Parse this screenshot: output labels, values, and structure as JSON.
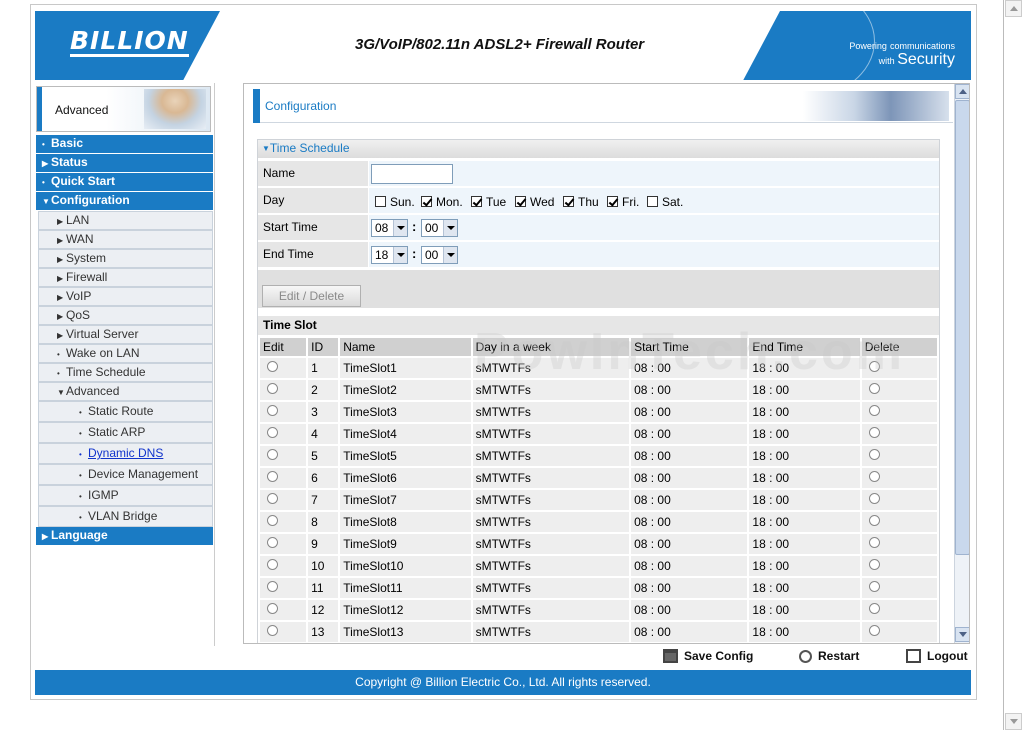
{
  "header": {
    "brand": "BILLION",
    "title": "3G/VoIP/802.11n ADSL2+ Firewall Router",
    "tagline_main": "Powering",
    "tagline_small": "communications",
    "tagline_with": "with",
    "tagline_security": "Security"
  },
  "sidebar": {
    "banner_label": "Advanced",
    "top_items": [
      "Basic",
      "Status",
      "Quick Start",
      "Configuration"
    ],
    "config_items": [
      "LAN",
      "WAN",
      "System",
      "Firewall",
      "VoIP",
      "QoS",
      "Virtual Server",
      "Wake on LAN",
      "Time Schedule",
      "Advanced"
    ],
    "advanced_items": [
      "Static Route",
      "Static ARP",
      "Dynamic DNS",
      "Device Management",
      "IGMP",
      "VLAN Bridge"
    ],
    "language": "Language"
  },
  "main": {
    "title": "Configuration",
    "section_title": "Time Schedule",
    "form": {
      "name_label": "Name",
      "name_value": "",
      "day_label": "Day",
      "days": [
        {
          "label": "Sun.",
          "checked": false
        },
        {
          "label": "Mon.",
          "checked": true
        },
        {
          "label": "Tue",
          "checked": true
        },
        {
          "label": "Wed",
          "checked": true
        },
        {
          "label": "Thu",
          "checked": true
        },
        {
          "label": "Fri.",
          "checked": true
        },
        {
          "label": "Sat.",
          "checked": false
        }
      ],
      "start_label": "Start Time",
      "start_hour": "08",
      "start_min": "00",
      "end_label": "End Time",
      "end_hour": "18",
      "end_min": "00",
      "colon": ":",
      "edit_delete_label": "Edit / Delete"
    },
    "timeslot": {
      "heading": "Time Slot",
      "columns": [
        "Edit",
        "ID",
        "Name",
        "Day in a week",
        "Start Time",
        "End Time",
        "Delete"
      ],
      "rows": [
        {
          "id": "1",
          "name": "TimeSlot1",
          "day": "sMTWTFs",
          "start": "08 : 00",
          "end": "18 : 00"
        },
        {
          "id": "2",
          "name": "TimeSlot2",
          "day": "sMTWTFs",
          "start": "08 : 00",
          "end": "18 : 00"
        },
        {
          "id": "3",
          "name": "TimeSlot3",
          "day": "sMTWTFs",
          "start": "08 : 00",
          "end": "18 : 00"
        },
        {
          "id": "4",
          "name": "TimeSlot4",
          "day": "sMTWTFs",
          "start": "08 : 00",
          "end": "18 : 00"
        },
        {
          "id": "5",
          "name": "TimeSlot5",
          "day": "sMTWTFs",
          "start": "08 : 00",
          "end": "18 : 00"
        },
        {
          "id": "6",
          "name": "TimeSlot6",
          "day": "sMTWTFs",
          "start": "08 : 00",
          "end": "18 : 00"
        },
        {
          "id": "7",
          "name": "TimeSlot7",
          "day": "sMTWTFs",
          "start": "08 : 00",
          "end": "18 : 00"
        },
        {
          "id": "8",
          "name": "TimeSlot8",
          "day": "sMTWTFs",
          "start": "08 : 00",
          "end": "18 : 00"
        },
        {
          "id": "9",
          "name": "TimeSlot9",
          "day": "sMTWTFs",
          "start": "08 : 00",
          "end": "18 : 00"
        },
        {
          "id": "10",
          "name": "TimeSlot10",
          "day": "sMTWTFs",
          "start": "08 : 00",
          "end": "18 : 00"
        },
        {
          "id": "11",
          "name": "TimeSlot11",
          "day": "sMTWTFs",
          "start": "08 : 00",
          "end": "18 : 00"
        },
        {
          "id": "12",
          "name": "TimeSlot12",
          "day": "sMTWTFs",
          "start": "08 : 00",
          "end": "18 : 00"
        },
        {
          "id": "13",
          "name": "TimeSlot13",
          "day": "sMTWTFs",
          "start": "08 : 00",
          "end": "18 : 00"
        }
      ]
    }
  },
  "actions": {
    "save": "Save Config",
    "restart": "Restart",
    "logout": "Logout"
  },
  "footer": "Copyright @ Billion Electric Co., Ltd. All rights reserved.",
  "watermark": "PowInTech.com",
  "colors": {
    "accent": "#1a7bc4",
    "link": "#1133cc"
  },
  "icons": {
    "save": "floppy-disk-icon",
    "restart": "restart-arrows-icon",
    "logout": "logout-door-icon"
  }
}
